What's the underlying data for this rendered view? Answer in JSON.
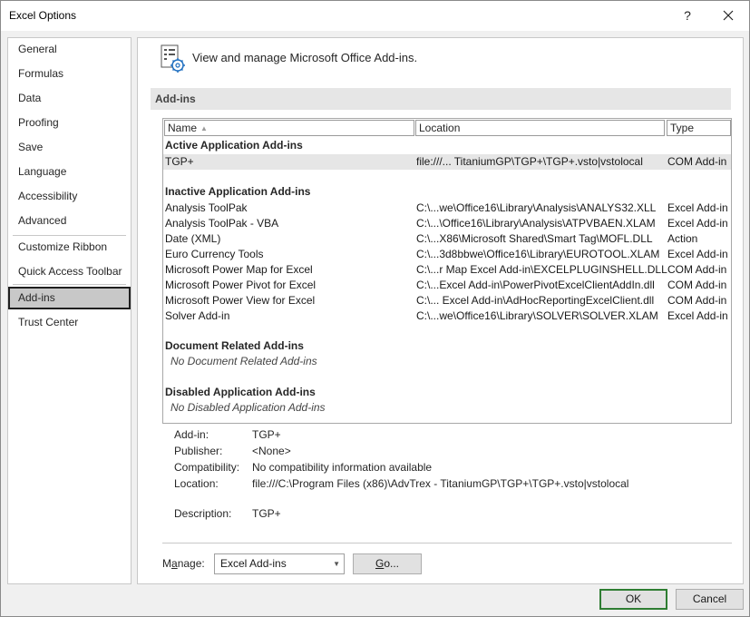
{
  "window": {
    "title": "Excel Options",
    "help_label": "?"
  },
  "sidebar": {
    "items": [
      {
        "label": "General"
      },
      {
        "label": "Formulas"
      },
      {
        "label": "Data"
      },
      {
        "label": "Proofing"
      },
      {
        "label": "Save"
      },
      {
        "label": "Language"
      },
      {
        "label": "Accessibility"
      },
      {
        "label": "Advanced"
      },
      {
        "label": "Customize Ribbon"
      },
      {
        "label": "Quick Access Toolbar"
      },
      {
        "label": "Add-ins",
        "selected": true
      },
      {
        "label": "Trust Center"
      }
    ]
  },
  "main": {
    "header_text": "View and manage Microsoft Office Add-ins.",
    "header_icon": "addins-gear-icon",
    "section_title": "Add-ins",
    "columns": {
      "name": "Name",
      "location": "Location",
      "type": "Type"
    },
    "groups": {
      "active": {
        "label": "Active Application Add-ins",
        "rows": [
          {
            "name": "TGP+",
            "location": "file:///... TitaniumGP\\TGP+\\TGP+.vsto|vstolocal",
            "type": "COM Add-in"
          }
        ]
      },
      "inactive": {
        "label": "Inactive Application Add-ins",
        "rows": [
          {
            "name": "Analysis ToolPak",
            "location": "C:\\...we\\Office16\\Library\\Analysis\\ANALYS32.XLL",
            "type": "Excel Add-in"
          },
          {
            "name": "Analysis ToolPak - VBA",
            "location": "C:\\...\\Office16\\Library\\Analysis\\ATPVBAEN.XLAM",
            "type": "Excel Add-in"
          },
          {
            "name": "Date (XML)",
            "location": "C:\\...X86\\Microsoft Shared\\Smart Tag\\MOFL.DLL",
            "type": "Action"
          },
          {
            "name": "Euro Currency Tools",
            "location": "C:\\...3d8bbwe\\Office16\\Library\\EUROTOOL.XLAM",
            "type": "Excel Add-in"
          },
          {
            "name": "Microsoft Power Map for Excel",
            "location": "C:\\...r Map Excel Add-in\\EXCELPLUGINSHELL.DLL",
            "type": "COM Add-in"
          },
          {
            "name": "Microsoft Power Pivot for Excel",
            "location": "C:\\...Excel Add-in\\PowerPivotExcelClientAddIn.dll",
            "type": "COM Add-in"
          },
          {
            "name": "Microsoft Power View for Excel",
            "location": "C:\\... Excel Add-in\\AdHocReportingExcelClient.dll",
            "type": "COM Add-in"
          },
          {
            "name": "Solver Add-in",
            "location": "C:\\...we\\Office16\\Library\\SOLVER\\SOLVER.XLAM",
            "type": "Excel Add-in"
          }
        ]
      },
      "document": {
        "label": "Document Related Add-ins",
        "empty": "No Document Related Add-ins"
      },
      "disabled": {
        "label": "Disabled Application Add-ins",
        "empty": "No Disabled Application Add-ins"
      }
    },
    "details": {
      "addin_label": "Add-in:",
      "addin_value": "TGP+",
      "publisher_label": "Publisher:",
      "publisher_value": "<None>",
      "compat_label": "Compatibility:",
      "compat_value": "No compatibility information available",
      "location_label": "Location:",
      "location_value": "file:///C:\\Program Files (x86)\\AdvTrex - TitaniumGP\\TGP+\\TGP+.vsto|vstolocal",
      "description_label": "Description:",
      "description_value": "TGP+"
    },
    "manage": {
      "label_prefix": "M",
      "label_underlined": "a",
      "label_suffix": "nage:",
      "selected_value": "Excel Add-ins",
      "go_underlined": "G",
      "go_suffix": "o..."
    }
  },
  "footer": {
    "ok_label": "OK",
    "cancel_label": "Cancel"
  }
}
